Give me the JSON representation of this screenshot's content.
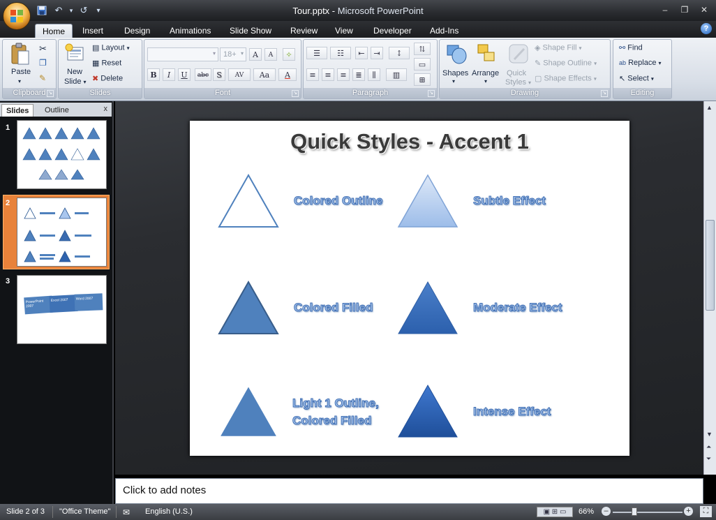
{
  "window": {
    "file": "Tour.pptx",
    "sep": " - ",
    "app": "Microsoft PowerPoint"
  },
  "qat": {
    "save": "save-icon",
    "undo": "undo-icon",
    "redo": "redo-icon",
    "customize": "▾"
  },
  "tabs": [
    "Home",
    "Insert",
    "Design",
    "Animations",
    "Slide Show",
    "Review",
    "View",
    "Developer",
    "Add-Ins"
  ],
  "ribbon": {
    "clipboard": {
      "label": "Clipboard",
      "paste": "Paste"
    },
    "slides": {
      "label": "Slides",
      "new_slide_1": "New",
      "new_slide_2": "Slide",
      "layout": "Layout",
      "reset": "Reset",
      "delete": "Delete"
    },
    "font": {
      "label": "Font",
      "size": "18+",
      "bold": "B",
      "italic": "I",
      "underline": "U",
      "strike": "abc",
      "shadow": "S",
      "spacing": "AV",
      "case": "Aa",
      "color": "A",
      "grow": "A",
      "shrink": "A"
    },
    "paragraph": {
      "label": "Paragraph"
    },
    "drawing": {
      "label": "Drawing",
      "shapes": "Shapes",
      "arrange": "Arrange",
      "quick_styles_1": "Quick",
      "quick_styles_2": "Styles",
      "shape_fill": "Shape Fill",
      "shape_outline": "Shape Outline",
      "shape_effects": "Shape Effects"
    },
    "editing": {
      "label": "Editing",
      "find": "Find",
      "replace": "Replace",
      "select": "Select"
    }
  },
  "panel": {
    "tab_slides": "Slides",
    "tab_outline": "Outline",
    "close": "x",
    "thumbs": [
      "1",
      "2",
      "3"
    ],
    "thumb3_cards": [
      "PowerPoint 2007",
      "Excel 2007",
      "Word 2007"
    ]
  },
  "slide": {
    "title": "Quick Styles - Accent 1",
    "labels": {
      "colored_outline": "Colored Outline",
      "subtle_effect": "Subtle Effect",
      "colored_filled": "Colored Filled",
      "moderate_effect": "Moderate Effect",
      "light1_line1": "Light 1 Outline,",
      "light1_line2": "Colored Filled",
      "intense_effect": "Intense Effect"
    }
  },
  "notes": {
    "placeholder": "Click to add notes"
  },
  "status": {
    "slide": "Slide 2 of 3",
    "theme": "\"Office Theme\"",
    "language": "English (U.S.)",
    "zoom": "66%"
  },
  "colors": {
    "accent": "#4f81bd",
    "selected_thumb": "#e8823a"
  }
}
